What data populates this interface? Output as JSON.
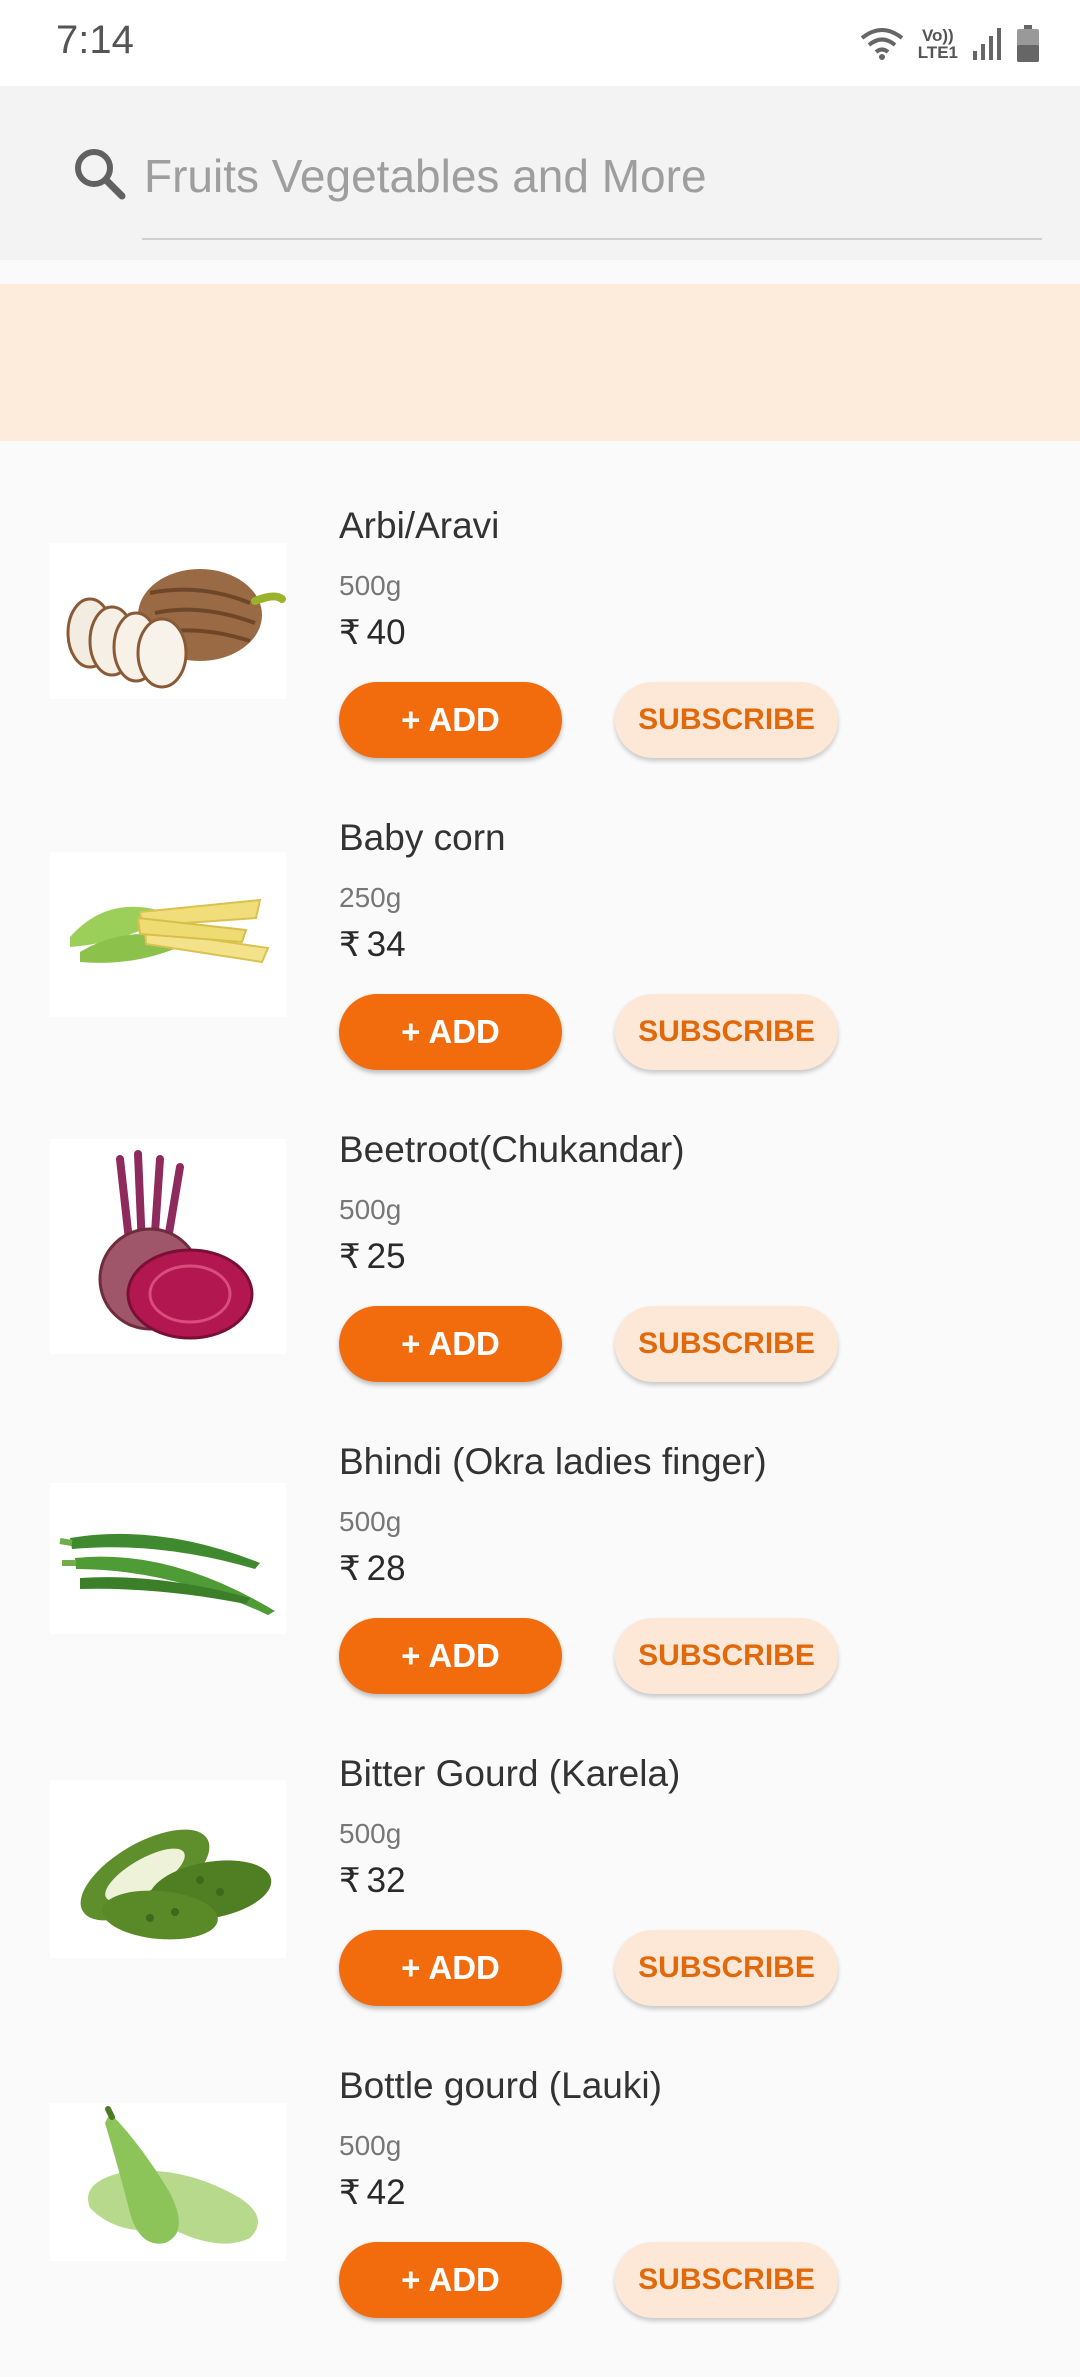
{
  "status": {
    "time": "7:14",
    "lte_line1": "Vo))",
    "lte_line2": "LTE1"
  },
  "search": {
    "placeholder": "Fruits Vegetables and More",
    "value": ""
  },
  "products": [
    {
      "name": "Arbi/Aravi",
      "qty": "500g",
      "price": "40",
      "currency": "₹",
      "add_label": "+ ADD",
      "subscribe_label": "SUBSCRIBE"
    },
    {
      "name": "Baby corn",
      "qty": "250g",
      "price": "34",
      "currency": "₹",
      "add_label": "+ ADD",
      "subscribe_label": "SUBSCRIBE"
    },
    {
      "name": "Beetroot(Chukandar)",
      "qty": "500g",
      "price": "25",
      "currency": "₹",
      "add_label": "+ ADD",
      "subscribe_label": "SUBSCRIBE"
    },
    {
      "name": "Bhindi (Okra ladies finger)",
      "qty": "500g",
      "price": "28",
      "currency": "₹",
      "add_label": "+ ADD",
      "subscribe_label": "SUBSCRIBE"
    },
    {
      "name": "Bitter Gourd (Karela)",
      "qty": "500g",
      "price": "32",
      "currency": "₹",
      "add_label": "+ ADD",
      "subscribe_label": "SUBSCRIBE"
    },
    {
      "name": "Bottle gourd (Lauki)",
      "qty": "500g",
      "price": "42",
      "currency": "₹",
      "add_label": "+ ADD",
      "subscribe_label": "SUBSCRIBE"
    }
  ],
  "colors": {
    "accent": "#f26c0d",
    "banner": "#fdebdc",
    "subscribe_bg": "#fde7d6"
  }
}
